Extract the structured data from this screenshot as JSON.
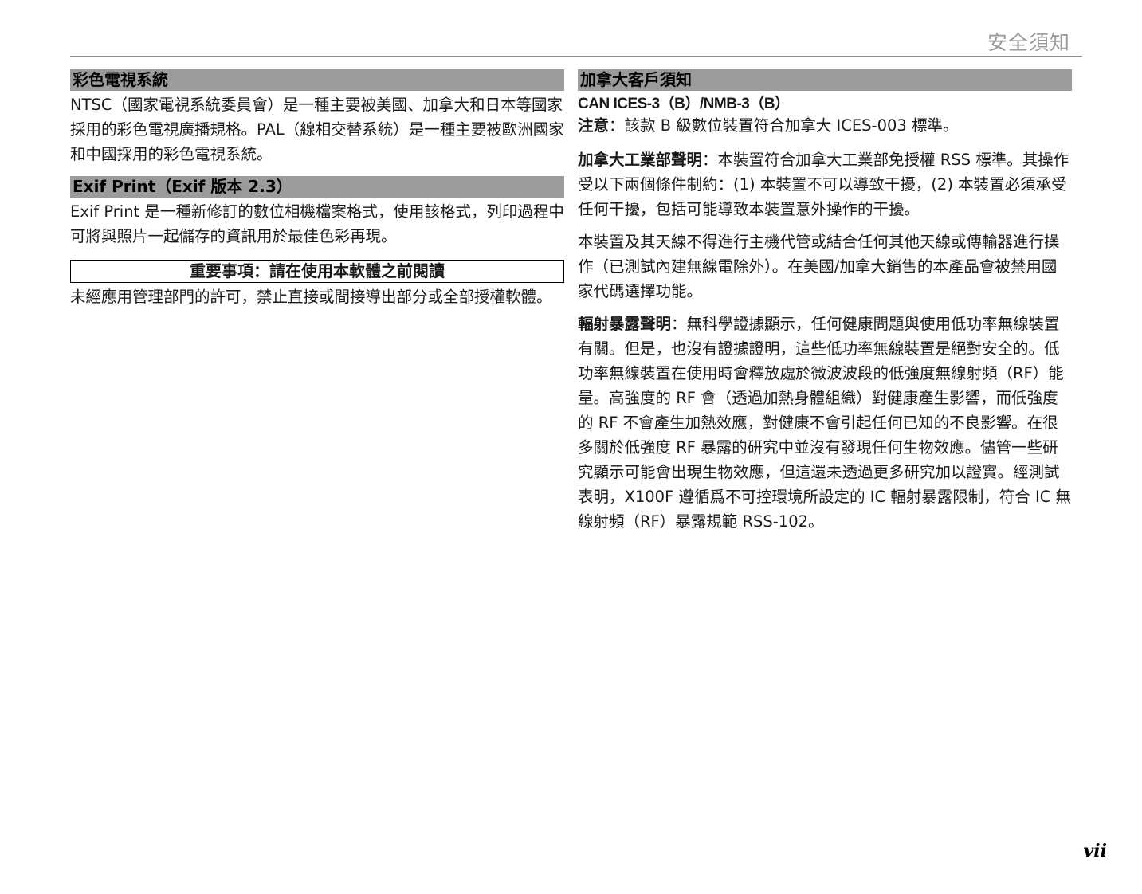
{
  "header": {
    "running_title": "安全須知"
  },
  "left": {
    "color_tv": {
      "title": "彩色電視系統",
      "body": "NTSC（國家電視系統委員會）是一種主要被美國、加拿大和日本等國家採用的彩色電視廣播規格。PAL（線相交替系統）是一種主要被歐洲國家和中國採用的彩色電視系統。"
    },
    "exif": {
      "title": "Exif Print（Exif 版本 2.3）",
      "body": "Exif Print 是一種新修訂的數位相機檔案格式，使用該格式，列印過程中可將與照片一起儲存的資訊用於最佳色彩再現。"
    },
    "important": {
      "title": "重要事項：請在使用本軟體之前閱讀",
      "body": "未經應用管理部門的許可，禁止直接或間接導出部分或全部授權軟體。"
    }
  },
  "right": {
    "title": "加拿大客戶須知",
    "can_code": "CAN ICES-3（B）/NMB-3（B）",
    "notice_lead": "注意",
    "notice_body": "：該款 B 級數位裝置符合加拿大 ICES-003 標準。",
    "industry_lead": "加拿大工業部聲明",
    "industry_body": "：本裝置符合加拿大工業部免授權 RSS 標準。其操作受以下兩個條件制約：(1) 本裝置不可以導致干擾，(2) 本裝置必須承受任何干擾，包括可能導致本裝置意外操作的干擾。",
    "antenna_body": "本裝置及其天線不得進行主機代管或結合任何其他天線或傳輸器進行操作（已測試內建無線電除外）。在美國/加拿大銷售的本產品會被禁用國家代碼選擇功能。",
    "radiation_lead": "輻射暴露聲明",
    "radiation_body": "：無科學證據顯示，任何健康問題與使用低功率無線裝置有關。但是，也沒有證據證明，這些低功率無線裝置是絕對安全的。低功率無線裝置在使用時會釋放處於微波波段的低強度無線射頻（RF）能量。高強度的 RF 會（透過加熱身體組織）對健康產生影響，而低強度的 RF 不會產生加熱效應，對健康不會引起任何已知的不良影響。在很多關於低強度 RF 暴露的研究中並沒有發現任何生物效應。儘管一些研究顯示可能會出現生物效應，但這還未透過更多研究加以證實。經測試表明，X100F 遵循爲不可控環境所設定的 IC 輻射暴露限制，符合 IC 無線射頻（RF）暴露規範 RSS-102。"
  },
  "footer": {
    "page_number": "vii"
  }
}
